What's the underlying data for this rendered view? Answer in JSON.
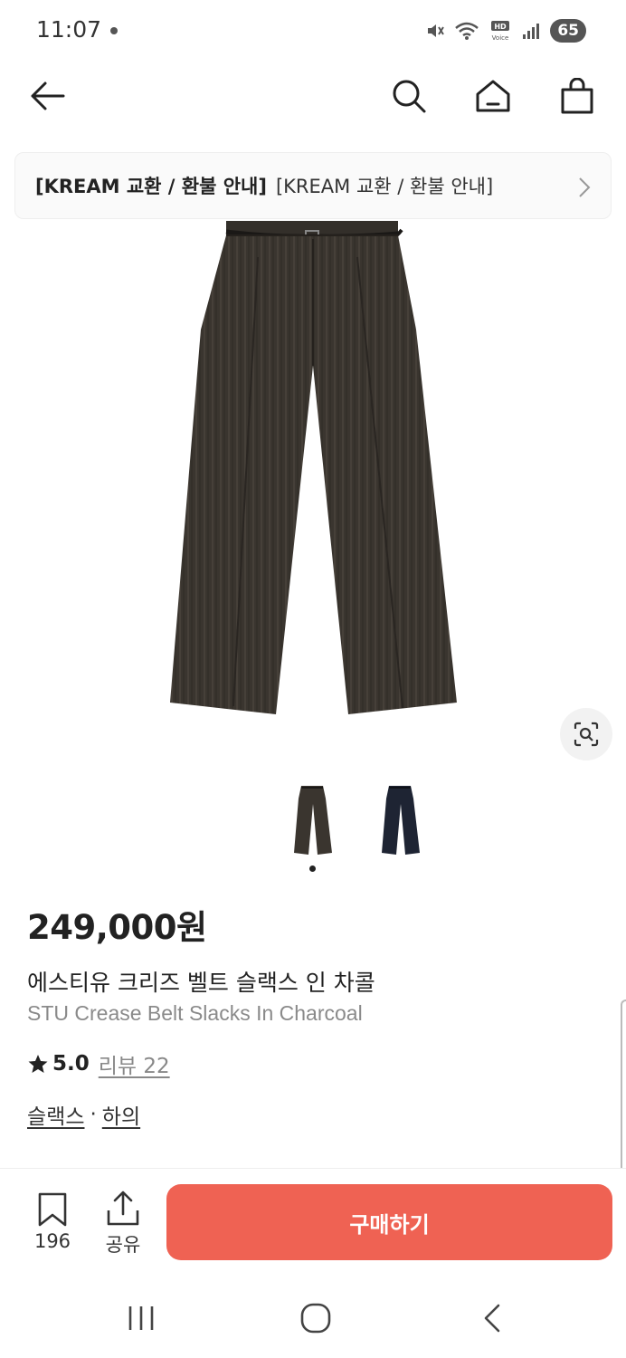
{
  "status_bar": {
    "time": "11:07",
    "battery": "65",
    "icons": [
      "mute-icon",
      "wifi-icon",
      "hd-voice-icon",
      "signal-icon"
    ]
  },
  "top_nav": {
    "icons": [
      "back-arrow-icon",
      "search-icon",
      "home-icon",
      "shopping-bag-icon"
    ]
  },
  "notice": {
    "bold_text": "[KREAM 교환 / 환불 안내]",
    "text": "[KREAM 교환 / 환불 안내]"
  },
  "product": {
    "price": "249,000원",
    "name_ko": "에스티유 크리즈 벨트 슬랙스 인 차콜",
    "name_en": "STU Crease Belt Slacks In Charcoal",
    "rating": "5.0",
    "review_label": "리뷰 22",
    "categories": [
      "슬랙스",
      "하의"
    ],
    "category_separator": "·",
    "colors": {
      "charcoal": "#3a352f",
      "navy": "#1e2433"
    },
    "image_count": 2,
    "current_image": 1
  },
  "actions": {
    "bookmark_count": "196",
    "share_label": "공유",
    "buy_label": "구매하기",
    "buy_color": "#ef6253"
  },
  "system_nav": {
    "icons": [
      "recent-apps-icon",
      "home-button-icon",
      "back-icon"
    ]
  }
}
